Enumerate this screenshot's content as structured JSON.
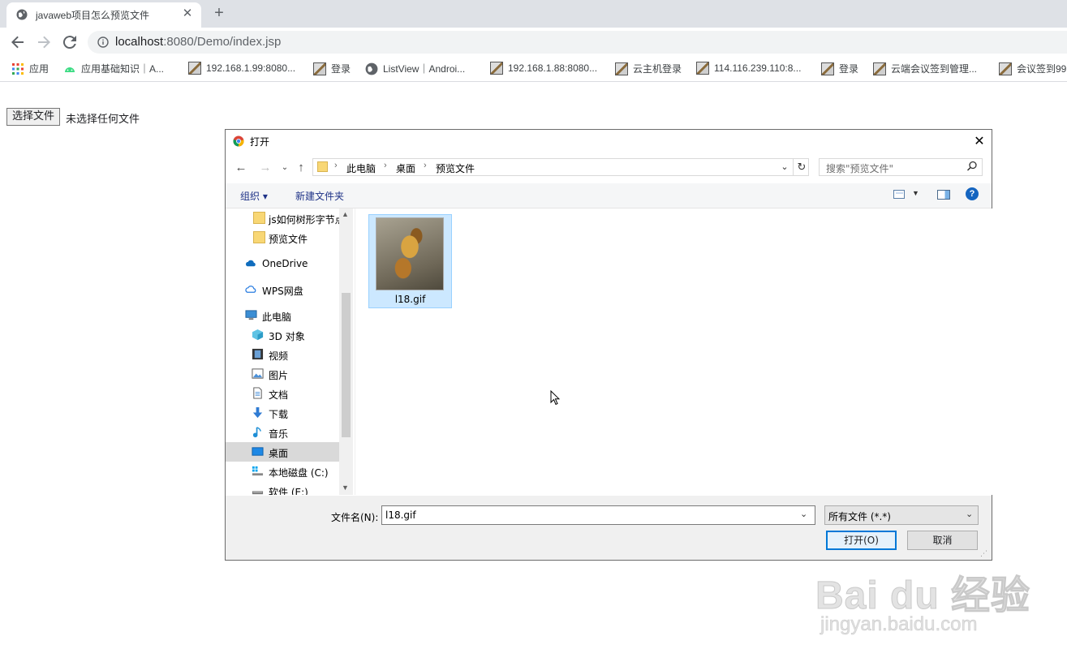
{
  "browser": {
    "tab_title": "javaweb项目怎么预览文件",
    "tab_close": "✕",
    "new_tab": "+",
    "url_host": "localhost",
    "url_path": ":8080/Demo/index.jsp",
    "bookmarks": [
      {
        "label": "应用",
        "icon": "apps-grid-icon"
      },
      {
        "label": "应用基础知识｜A...",
        "icon": "android-icon"
      },
      {
        "label": "192.168.1.99:8080...",
        "icon": "image-icon"
      },
      {
        "label": "登录",
        "icon": "image-icon"
      },
      {
        "label": "ListView｜Androi...",
        "icon": "globe-icon"
      },
      {
        "label": "192.168.1.88:8080...",
        "icon": "image-icon"
      },
      {
        "label": "云主机登录",
        "icon": "image-icon"
      },
      {
        "label": "114.116.239.110:8...",
        "icon": "image-icon"
      },
      {
        "label": "登录",
        "icon": "image-icon"
      },
      {
        "label": "云端会议签到管理...",
        "icon": "image-icon"
      },
      {
        "label": "会议签到99",
        "icon": "image-icon"
      }
    ]
  },
  "page": {
    "file_button": "选择文件",
    "file_status": "未选择任何文件"
  },
  "dialog": {
    "title": "打开",
    "breadcrumb": [
      "此电脑",
      "桌面",
      "预览文件"
    ],
    "search_placeholder": "搜索\"预览文件\"",
    "organize": "组织 ▾",
    "new_folder": "新建文件夹",
    "help": "?",
    "nav_items": [
      {
        "label": "js如何树形字节点",
        "icon": "folder-icon",
        "indent": 2
      },
      {
        "label": "预览文件",
        "icon": "folder-icon",
        "indent": 2
      },
      {
        "label": "OneDrive",
        "icon": "onedrive-cloud-icon",
        "indent": 1
      },
      {
        "label": "WPS网盘",
        "icon": "wps-cloud-icon",
        "indent": 1
      },
      {
        "label": "此电脑",
        "icon": "computer-icon",
        "indent": 1
      },
      {
        "label": "3D 对象",
        "icon": "cube-icon",
        "indent": 2
      },
      {
        "label": "视频",
        "icon": "video-icon",
        "indent": 2
      },
      {
        "label": "图片",
        "icon": "pictures-icon",
        "indent": 2
      },
      {
        "label": "文档",
        "icon": "documents-icon",
        "indent": 2
      },
      {
        "label": "下载",
        "icon": "download-icon",
        "indent": 2
      },
      {
        "label": "音乐",
        "icon": "music-icon",
        "indent": 2
      },
      {
        "label": "桌面",
        "icon": "desktop-icon",
        "indent": 2,
        "selected": true
      },
      {
        "label": "本地磁盘 (C:)",
        "icon": "drive-icon",
        "indent": 2
      },
      {
        "label": "软件 (E:)",
        "icon": "drive-icon",
        "indent": 2
      }
    ],
    "file": {
      "name": "l18.gif"
    },
    "filename_label": "文件名(N):",
    "filename_value": "l18.gif",
    "filetype_value": "所有文件 (*.*)",
    "open_button": "打开(O)",
    "cancel_button": "取消"
  },
  "watermark": {
    "brand": "Bai du 经验",
    "url": "jingyan.baidu.com"
  }
}
